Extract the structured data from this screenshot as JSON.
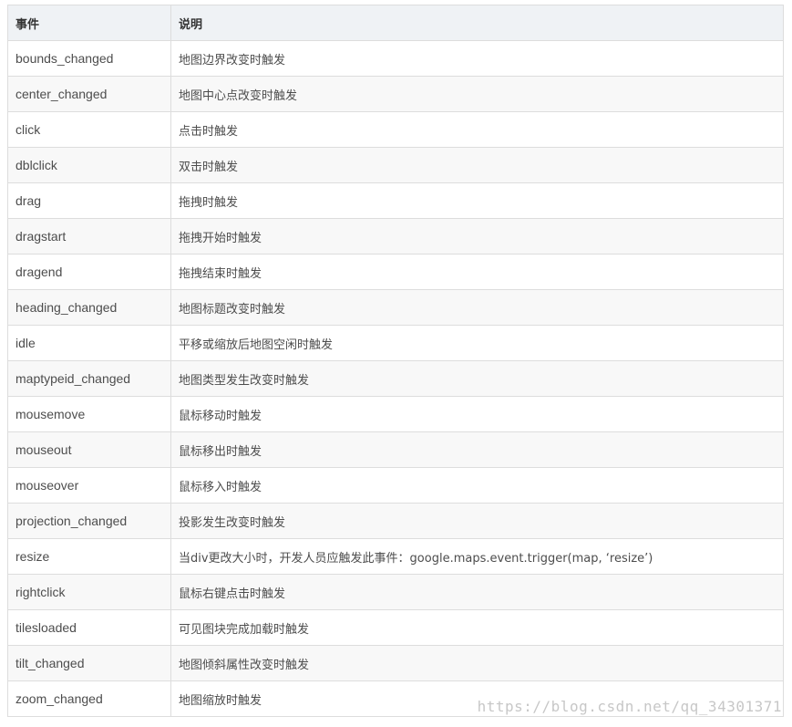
{
  "table": {
    "headers": {
      "event": "事件",
      "description": "说明"
    },
    "rows": [
      {
        "event": "bounds_changed",
        "description": "地图边界改变时触发"
      },
      {
        "event": "center_changed",
        "description": "地图中心点改变时触发"
      },
      {
        "event": "click",
        "description": "点击时触发"
      },
      {
        "event": "dblclick",
        "description": "双击时触发"
      },
      {
        "event": "drag",
        "description": "拖拽时触发"
      },
      {
        "event": "dragstart",
        "description": "拖拽开始时触发"
      },
      {
        "event": "dragend",
        "description": "拖拽结束时触发"
      },
      {
        "event": "heading_changed",
        "description": "地图标题改变时触发"
      },
      {
        "event": "idle",
        "description": "平移或缩放后地图空闲时触发"
      },
      {
        "event": "maptypeid_changed",
        "description": "地图类型发生改变时触发"
      },
      {
        "event": "mousemove",
        "description": "鼠标移动时触发"
      },
      {
        "event": "mouseout",
        "description": "鼠标移出时触发"
      },
      {
        "event": "mouseover",
        "description": "鼠标移入时触发"
      },
      {
        "event": "projection_changed",
        "description": "投影发生改变时触发"
      },
      {
        "event": "resize",
        "description": "当div更改大小时，开发人员应触发此事件：google.maps.event.trigger(map, ‘resize’)"
      },
      {
        "event": "rightclick",
        "description": "鼠标右键点击时触发"
      },
      {
        "event": "tilesloaded",
        "description": "可见图块完成加载时触发"
      },
      {
        "event": "tilt_changed",
        "description": "地图倾斜属性改变时触发"
      },
      {
        "event": "zoom_changed",
        "description": "地图缩放时触发"
      }
    ]
  },
  "watermark": "https://blog.csdn.net/qq_34301371"
}
